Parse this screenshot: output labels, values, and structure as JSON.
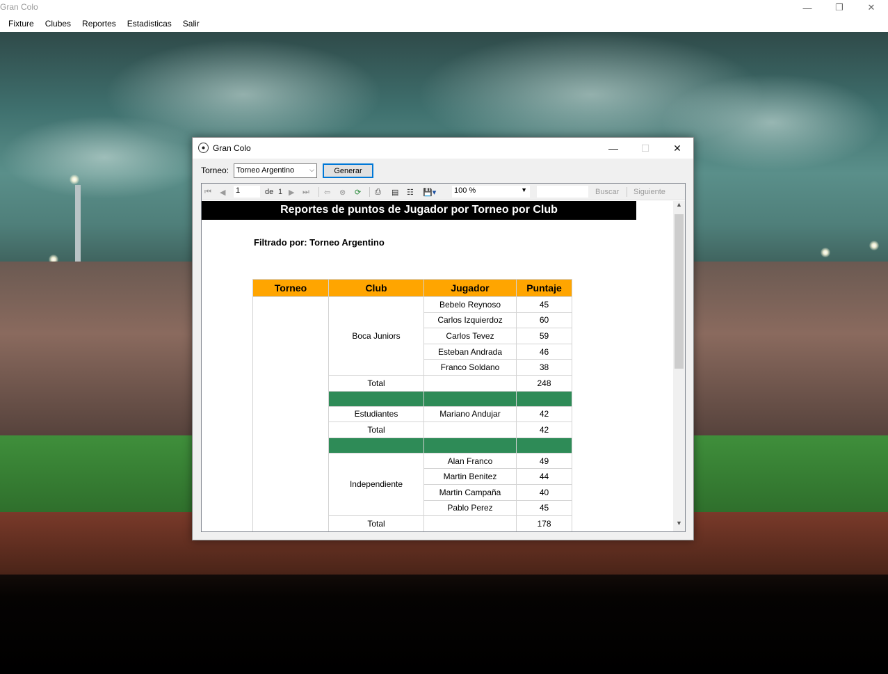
{
  "app": {
    "title": "Gran Colo",
    "menu": [
      "Fixture",
      "Clubes",
      "Reportes",
      "Estadisticas",
      "Salir"
    ]
  },
  "dialog": {
    "title": "Gran Colo",
    "torneo_label": "Torneo:",
    "torneo_value": "Torneo Argentino",
    "generar_label": "Generar"
  },
  "toolbar": {
    "page_current": "1",
    "page_of": "de",
    "page_total": "1",
    "zoom": "100 %",
    "buscar": "Buscar",
    "siguiente": "Siguiente"
  },
  "report": {
    "title": "Reportes de puntos de Jugador por Torneo por Club",
    "filter": "Filtrado por: Torneo Argentino",
    "columns": [
      "Torneo",
      "Club",
      "Jugador",
      "Puntaje"
    ],
    "total_label": "Total",
    "groups": [
      {
        "club": "Boca Juniors",
        "players": [
          {
            "name": "Bebelo Reynoso",
            "score": "45"
          },
          {
            "name": "Carlos Izquierdoz",
            "score": "60"
          },
          {
            "name": "Carlos Tevez",
            "score": "59"
          },
          {
            "name": "Esteban Andrada",
            "score": "46"
          },
          {
            "name": "Franco Soldano",
            "score": "38"
          }
        ],
        "total": "248"
      },
      {
        "club": "Estudiantes",
        "players": [
          {
            "name": "Mariano Andujar",
            "score": "42"
          }
        ],
        "total": "42"
      },
      {
        "club": "Independiente",
        "players": [
          {
            "name": "Alan Franco",
            "score": "49"
          },
          {
            "name": "Martin Benitez",
            "score": "44"
          },
          {
            "name": "Martin Campaña",
            "score": "40"
          },
          {
            "name": "Pablo Perez",
            "score": "45"
          }
        ],
        "total": "178"
      }
    ]
  },
  "colors": {
    "header_orange": "#ffa500",
    "separator_green": "#2e8b57",
    "title_black": "#000000",
    "accent_blue": "#0078d7"
  }
}
